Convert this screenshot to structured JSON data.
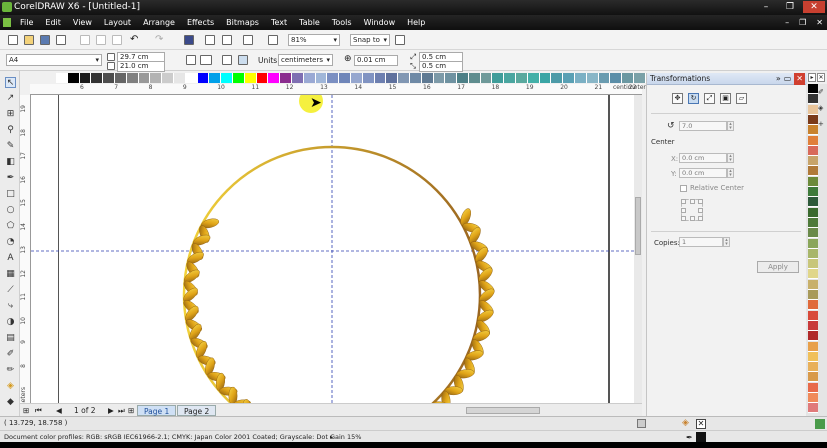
{
  "window": {
    "title": "CorelDRAW X6 - [Untitled-1]",
    "controls": [
      "–",
      "❐",
      "✕"
    ]
  },
  "menu": {
    "items": [
      "File",
      "Edit",
      "View",
      "Layout",
      "Arrange",
      "Effects",
      "Bitmaps",
      "Text",
      "Table",
      "Tools",
      "Window",
      "Help"
    ],
    "right_controls": [
      "–",
      "❐",
      "✕"
    ]
  },
  "toolbar": {
    "zoom": "81%",
    "snap_to": "Snap to"
  },
  "property_bar": {
    "page_size": "A4",
    "width": "29.7 cm",
    "height": "21.0 cm",
    "units_label": "Units:",
    "units": "centimeters",
    "nudge": "0.01 cm",
    "dup_x": "0.5 cm",
    "dup_y": "0.5 cm"
  },
  "rulers": {
    "h_ticks": [
      "6",
      "7",
      "8",
      "9",
      "10",
      "11",
      "12",
      "13",
      "14",
      "15",
      "16",
      "17",
      "18",
      "19",
      "20",
      "21",
      "22"
    ],
    "h_unit": "centimeters",
    "v_ticks": [
      "19",
      "18",
      "17",
      "16",
      "15",
      "14",
      "13",
      "12",
      "11",
      "10",
      "9",
      "8"
    ],
    "v_unit": "centimeters"
  },
  "palette": {
    "top_colors": [
      "#ffffff",
      "#000000",
      "#1a1a1a",
      "#333333",
      "#4d4d4d",
      "#666666",
      "#808080",
      "#999999",
      "#b3b3b3",
      "#cccccc",
      "#e6e6e6",
      "#ffffff",
      "#0000ff",
      "#00a0e9",
      "#00ffff",
      "#00ff00",
      "#ffff00",
      "#ff0000",
      "#ff00ff",
      "#8b2c8f",
      "#7f6fb2",
      "#9aa9d4",
      "#a0b6d8",
      "#7b8fc2",
      "#6f86b9",
      "#96a7cf",
      "#8093c2",
      "#6d7fb0",
      "#5f719d",
      "#8197b3",
      "#6f8aa6",
      "#5f7a93",
      "#7d9aa8",
      "#6f92a1",
      "#4d8087",
      "#5f8d8f",
      "#6f9a9a",
      "#3f9d9a",
      "#4aa6a0",
      "#5aa99e",
      "#44b0a8",
      "#3aa5a5",
      "#4d9ba8",
      "#5aa0b4",
      "#7bb0c4",
      "#89b6c7",
      "#6a9cb0",
      "#5b8ea8",
      "#6b98a2",
      "#7aa1a8"
    ],
    "right_colors": [
      "#000000",
      "#333333",
      "#e8c49a",
      "#7a3a1a",
      "#c8822e",
      "#e07f3a",
      "#d86a5a",
      "#c7a46a",
      "#b07a3a",
      "#6b8a3a",
      "#3e7a3a",
      "#2e5a3a",
      "#3a6a2e",
      "#4e7a3a",
      "#6a8a4a",
      "#8aa65a",
      "#a8b66a",
      "#c8c67a",
      "#e0d68a",
      "#c8b06a",
      "#a89a5a",
      "#e06a3a",
      "#d84a3a",
      "#c83a3a",
      "#b02a2a",
      "#e8a04a",
      "#f0c05a",
      "#e8b05a",
      "#d89a4a",
      "#e86a4a",
      "#f08a5a",
      "#e07a7a"
    ]
  },
  "page_nav": {
    "counter": "1 of 2",
    "tabs": [
      "Page 1",
      "Page 2"
    ]
  },
  "status": {
    "coordinates": "( 13.729, 18.758 )",
    "color_profiles": "Document color profiles: RGB: sRGB IEC61966-2.1; CMYK: Japan Color 2001 Coated; Grayscale: Dot Gain 15%"
  },
  "docker": {
    "title": "Transformations",
    "angle": "7.0",
    "center_label": "Center",
    "x_label": "X:",
    "x_value": "0.0 cm",
    "y_label": "Y:",
    "y_value": "0.0 cm",
    "relative_center": "Relative Center",
    "copies_label": "Copies:",
    "copies_value": "1",
    "apply": "Apply"
  }
}
